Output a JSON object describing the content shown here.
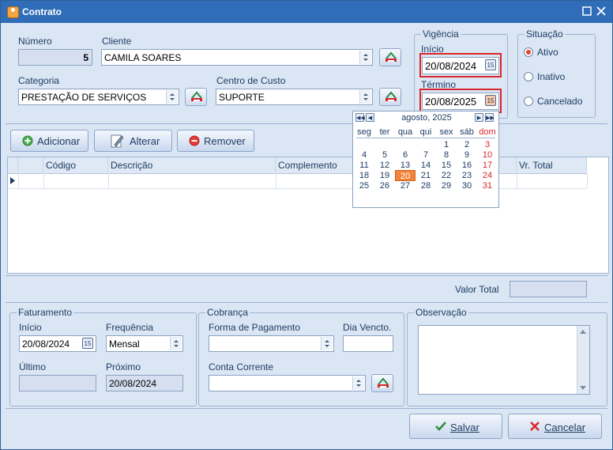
{
  "window": {
    "title": "Contrato"
  },
  "header": {
    "numero": {
      "label": "Número",
      "value": "5"
    },
    "cliente": {
      "label": "Cliente",
      "value": "CAMILA SOARES"
    },
    "categoria": {
      "label": "Categoria",
      "value": "PRESTAÇÃO DE SERVIÇOS"
    },
    "centro_custo": {
      "label": "Centro de Custo",
      "value": "SUPORTE"
    }
  },
  "vigencia": {
    "title": "Vigência",
    "inicio": {
      "label": "Início",
      "value": "20/08/2024"
    },
    "termino": {
      "label": "Término",
      "value": "20/08/2025"
    }
  },
  "situacao": {
    "title": "Situação",
    "options": [
      "Ativo",
      "Inativo",
      "Cancelado"
    ],
    "selected": "Ativo"
  },
  "toolbar": {
    "adicionar": "Adicionar",
    "alterar": "Alterar",
    "remover": "Remover"
  },
  "grid": {
    "columns": [
      "Código",
      "Descrição",
      "Complemento",
      "Vr. Total"
    ],
    "rows": []
  },
  "calendar": {
    "month_label": "agosto, 2025",
    "weekdays": [
      "seg",
      "ter",
      "qua",
      "qui",
      "sex",
      "sáb",
      "dom"
    ],
    "weeks": [
      [
        "",
        "",
        "",
        "",
        "1",
        "2",
        "3"
      ],
      [
        "4",
        "5",
        "6",
        "7",
        "8",
        "9",
        "10"
      ],
      [
        "11",
        "12",
        "13",
        "14",
        "15",
        "16",
        "17"
      ],
      [
        "18",
        "19",
        "20",
        "21",
        "22",
        "23",
        "24"
      ],
      [
        "25",
        "26",
        "27",
        "28",
        "29",
        "30",
        "31"
      ]
    ],
    "selected_day": "20",
    "button_glyph": "15"
  },
  "totals": {
    "valor_total_label": "Valor Total",
    "valor_total": ""
  },
  "faturamento": {
    "title": "Faturamento",
    "inicio": {
      "label": "Início",
      "value": "20/08/2024"
    },
    "frequencia": {
      "label": "Frequência",
      "value": "Mensal"
    },
    "ultimo": {
      "label": "Último",
      "value": ""
    },
    "proximo": {
      "label": "Próximo",
      "value": "20/08/2024"
    }
  },
  "cobranca": {
    "title": "Cobrança",
    "forma_pagamento": {
      "label": "Forma de Pagamento",
      "value": ""
    },
    "dia_vencto": {
      "label": "Dia Vencto.",
      "value": ""
    },
    "conta_corrente": {
      "label": "Conta Corrente",
      "value": ""
    }
  },
  "observacao": {
    "title": "Observação",
    "value": ""
  },
  "footer": {
    "salvar": "Salvar",
    "cancelar": "Cancelar"
  },
  "colors": {
    "titlebar": "#2f6db8",
    "panel": "#dbe6f4",
    "highlight_red": "#d9262b",
    "today_orange": "#f2843c"
  }
}
